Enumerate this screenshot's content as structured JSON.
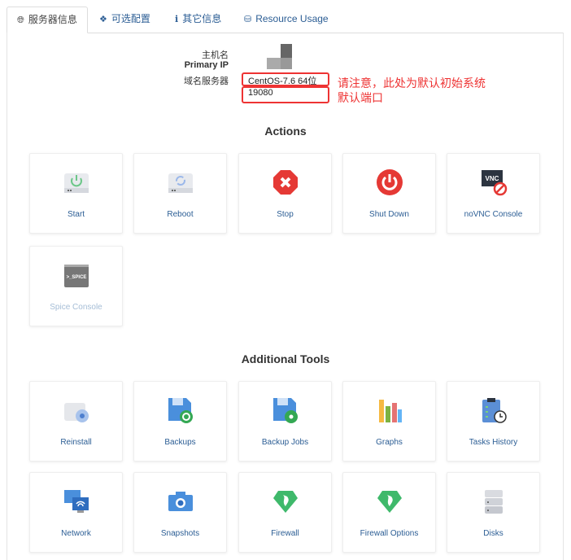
{
  "tabs": [
    {
      "label": "服务器信息",
      "icon": "globe-icon",
      "active": true
    },
    {
      "label": "可选配置",
      "icon": "cubes-icon"
    },
    {
      "label": "其它信息",
      "icon": "info-icon"
    },
    {
      "label": "Resource Usage",
      "icon": "hdd-icon"
    }
  ],
  "info": {
    "hostname_label": "主机名",
    "primary_ip_label": "Primary IP",
    "dns_label": "域名服务器",
    "os_value": "CentOS-7.6 64位",
    "port_value": "19080"
  },
  "annotations": {
    "note1": "请注意，此处为默认初始系统",
    "note2": "默认端口",
    "color": "#ee3333"
  },
  "actions_title": "Actions",
  "actions": [
    {
      "label": "Start",
      "icon": "start-drive-icon"
    },
    {
      "label": "Reboot",
      "icon": "reboot-drive-icon"
    },
    {
      "label": "Stop",
      "icon": "stop-icon"
    },
    {
      "label": "Shut Down",
      "icon": "power-icon"
    },
    {
      "label": "noVNC Console",
      "icon": "vnc-icon",
      "icon_text": "VNC"
    },
    {
      "label": "Spice Console",
      "icon": "spice-icon",
      "icon_text": ">_SPICE",
      "disabled": true
    }
  ],
  "tools_title": "Additional Tools",
  "tools": [
    {
      "label": "Reinstall",
      "icon": "reinstall-icon"
    },
    {
      "label": "Backups",
      "icon": "backup-icon"
    },
    {
      "label": "Backup Jobs",
      "icon": "backup-jobs-icon"
    },
    {
      "label": "Graphs",
      "icon": "graphs-icon"
    },
    {
      "label": "Tasks History",
      "icon": "tasks-history-icon"
    },
    {
      "label": "Network",
      "icon": "network-icon"
    },
    {
      "label": "Snapshots",
      "icon": "snapshots-icon"
    },
    {
      "label": "Firewall",
      "icon": "firewall-icon"
    },
    {
      "label": "Firewall Options",
      "icon": "firewall-options-icon"
    },
    {
      "label": "Disks",
      "icon": "disks-icon"
    }
  ]
}
